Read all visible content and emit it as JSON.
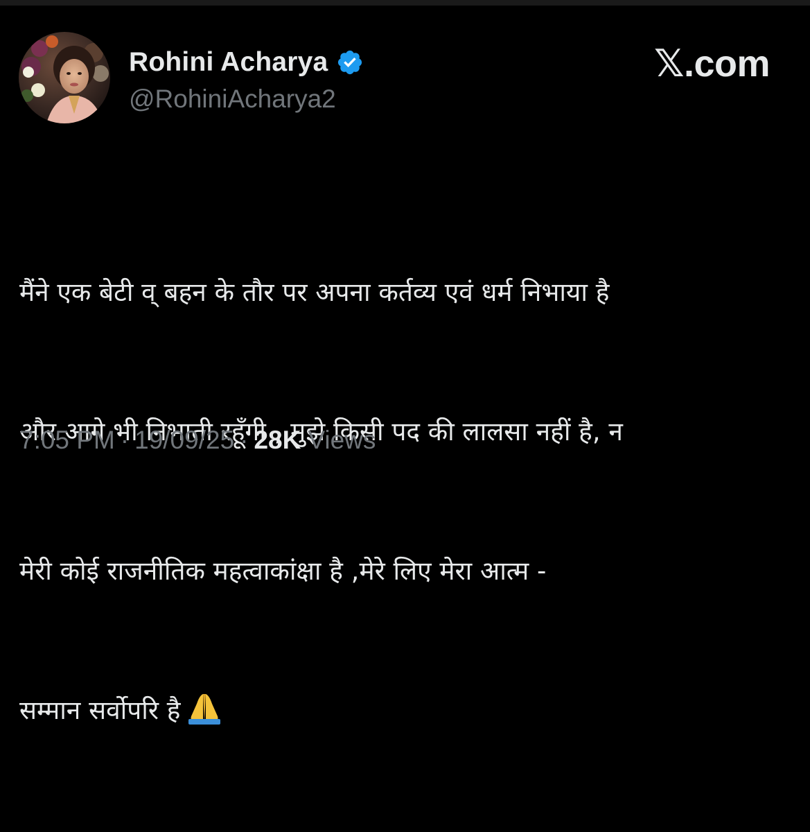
{
  "author": {
    "display_name": "Rohini Acharya",
    "handle": "@RohiniAcharya2",
    "verified": true
  },
  "brand": {
    "x_glyph": "𝕏",
    "domain": ".com"
  },
  "tweet": {
    "lines": [
      "मैंने एक बेटी व् बहन के तौर पर अपना कर्तव्य एवं धर्म निभाया है",
      "और आगे भी निभाती रहूँगी , मुझे किसी पद की लालसा नहीं है, न",
      "मेरी कोई राजनीतिक महत्वाकांक्षा है ,मेरे लिए मेरा आत्म -",
      "सम्मान सर्वोपरि है"
    ]
  },
  "meta": {
    "time": "7:05 PM",
    "separator": "·",
    "date": "19/09/25",
    "views_count": "28K",
    "views_label": "Views"
  },
  "colors": {
    "background": "#000000",
    "primary_text": "#e7e9ea",
    "secondary_text": "#71767b",
    "verified_blue": "#1d9bf0"
  },
  "icons": {
    "verified": "verified-badge-icon",
    "emoji": "folded-hands-emoji"
  }
}
